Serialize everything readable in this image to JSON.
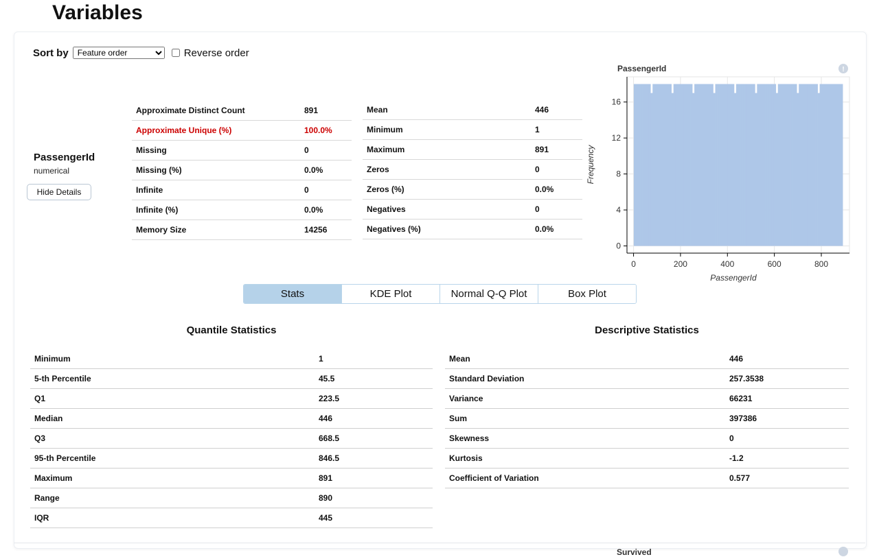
{
  "page": {
    "title": "Variables"
  },
  "sort": {
    "label": "Sort by",
    "selected": "Feature order",
    "reverse_label": "Reverse order",
    "reverse_checked": false
  },
  "variable": {
    "name": "PassengerId",
    "type": "numerical",
    "hide_button": "Hide Details"
  },
  "basic_left": [
    {
      "label": "Approximate Distinct Count",
      "value": "891",
      "warn": false
    },
    {
      "label": "Approximate Unique (%)",
      "value": "100.0%",
      "warn": true
    },
    {
      "label": "Missing",
      "value": "0",
      "warn": false
    },
    {
      "label": "Missing (%)",
      "value": "0.0%",
      "warn": false
    },
    {
      "label": "Infinite",
      "value": "0",
      "warn": false
    },
    {
      "label": "Infinite (%)",
      "value": "0.0%",
      "warn": false
    },
    {
      "label": "Memory Size",
      "value": "14256",
      "warn": false
    }
  ],
  "basic_right": [
    {
      "label": "Mean",
      "value": "446"
    },
    {
      "label": "Minimum",
      "value": "1"
    },
    {
      "label": "Maximum",
      "value": "891"
    },
    {
      "label": "Zeros",
      "value": "0"
    },
    {
      "label": "Zeros (%)",
      "value": "0.0%"
    },
    {
      "label": "Negatives",
      "value": "0"
    },
    {
      "label": "Negatives (%)",
      "value": "0.0%"
    }
  ],
  "chart_data": {
    "type": "bar",
    "title": "PassengerId",
    "xlabel": "PassengerId",
    "ylabel": "Frequency",
    "xlim": [
      -28,
      920
    ],
    "ylim": [
      -0.8,
      18.8
    ],
    "x_ticks": [
      0,
      200,
      400,
      600,
      800
    ],
    "y_ticks": [
      0,
      4,
      8,
      12,
      16
    ],
    "bin_width": 8.9,
    "bin_start": 1,
    "values": [
      18,
      18,
      18,
      18,
      18,
      18,
      18,
      18,
      17,
      18,
      18,
      18,
      18,
      18,
      18,
      18,
      18,
      18,
      17,
      18,
      18,
      18,
      18,
      18,
      18,
      18,
      18,
      18,
      17,
      18,
      18,
      18,
      18,
      18,
      18,
      18,
      18,
      18,
      17,
      18,
      18,
      18,
      18,
      18,
      18,
      18,
      18,
      18,
      17,
      18,
      18,
      18,
      18,
      18,
      18,
      18,
      18,
      18,
      17,
      18,
      18,
      18,
      18,
      18,
      18,
      18,
      18,
      18,
      17,
      18,
      18,
      18,
      18,
      18,
      18,
      18,
      18,
      18,
      17,
      18,
      18,
      18,
      18,
      18,
      18,
      18,
      18,
      18,
      17,
      18,
      18,
      18,
      18,
      18,
      18,
      18,
      18,
      18,
      18,
      18
    ],
    "bar_color": "#aec7e8",
    "grid": true
  },
  "tabs": [
    {
      "label": "Stats",
      "active": true
    },
    {
      "label": "KDE Plot",
      "active": false
    },
    {
      "label": "Normal Q-Q Plot",
      "active": false
    },
    {
      "label": "Box Plot",
      "active": false
    }
  ],
  "quantile": {
    "title": "Quantile Statistics",
    "rows": [
      {
        "label": "Minimum",
        "value": "1"
      },
      {
        "label": "5-th Percentile",
        "value": "45.5"
      },
      {
        "label": "Q1",
        "value": "223.5"
      },
      {
        "label": "Median",
        "value": "446"
      },
      {
        "label": "Q3",
        "value": "668.5"
      },
      {
        "label": "95-th Percentile",
        "value": "846.5"
      },
      {
        "label": "Maximum",
        "value": "891"
      },
      {
        "label": "Range",
        "value": "890"
      },
      {
        "label": "IQR",
        "value": "445"
      }
    ]
  },
  "descriptive": {
    "title": "Descriptive Statistics",
    "rows": [
      {
        "label": "Mean",
        "value": "446"
      },
      {
        "label": "Standard Deviation",
        "value": "257.3538"
      },
      {
        "label": "Variance",
        "value": "66231"
      },
      {
        "label": "Sum",
        "value": "397386"
      },
      {
        "label": "Skewness",
        "value": "0"
      },
      {
        "label": "Kurtosis",
        "value": "-1.2"
      },
      {
        "label": "Coefficient of Variation",
        "value": "0.577"
      }
    ]
  },
  "next_variable": {
    "name": "Survived"
  },
  "colors": {
    "warn": "#cc0000",
    "tab_active": "#b5d2e9",
    "info_icon": "#cdd6e2"
  }
}
